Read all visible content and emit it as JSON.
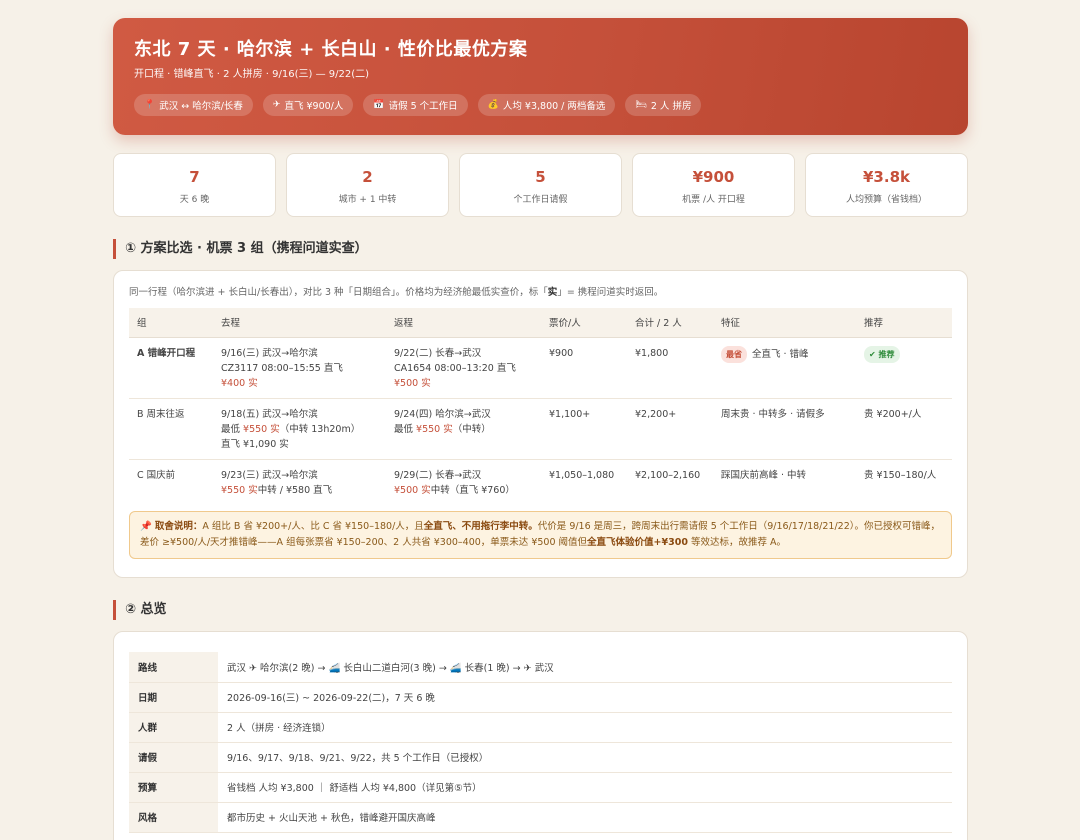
{
  "hero": {
    "title": "东北 7 天 · 哈尔滨 + 长白山 · 性价比最优方案",
    "subtitle": "开口程 · 错峰直飞 · 2 人拼房 · 9/16(三) — 9/22(二)",
    "chips": [
      {
        "icon": "pin-icon",
        "glyph": "📍",
        "label": "武汉 ↔ 哈尔滨/长春"
      },
      {
        "icon": "plane-icon",
        "glyph": "✈",
        "label": "直飞 ¥900/人"
      },
      {
        "icon": "calendar-icon",
        "glyph": "📅",
        "label": "请假 5 个工作日"
      },
      {
        "icon": "money-icon",
        "glyph": "💰",
        "label": "人均 ¥3,800 / 两档备选"
      },
      {
        "icon": "bed-icon",
        "glyph": "🛏",
        "label": "2 人 拼房"
      }
    ]
  },
  "stats": [
    {
      "value": "7",
      "label": "天 6 晚"
    },
    {
      "value": "2",
      "label": "城市 + 1 中转"
    },
    {
      "value": "5",
      "label": "个工作日请假"
    },
    {
      "value": "¥900",
      "label": "机票 /人 开口程"
    },
    {
      "value": "¥3.8k",
      "label": "人均预算（省钱档）"
    }
  ],
  "section1": {
    "title": "① 方案比选 · 机票 3 组（携程问道实查）",
    "intro_a": "同一行程（哈尔滨进 + 长白山/长春出），对比 3 种「日期组合」。价格均为经济舱最低实查价，标「",
    "intro_b": "实",
    "intro_c": "」= 携程问道实时返回。",
    "headers": [
      "组",
      "去程",
      "返程",
      "票价/人",
      "合计 / 2 人",
      "特征",
      "推荐"
    ],
    "rows": [
      {
        "group": "A 错峰开口程",
        "out": [
          "9/16(三) 武汉→哈尔滨",
          "CZ3117 08:00–15:55 直飞",
          "¥400 实"
        ],
        "ret": [
          "9/22(二) 长春→武汉",
          "CA1654 08:00–13:20 直飞",
          "¥500 实"
        ],
        "price": "¥900",
        "total": "¥1,800",
        "badge": "最省",
        "feature": "全直飞 · 错峰",
        "rec": "✔ 推荐"
      },
      {
        "group": "B 周末往返",
        "out": [
          "9/18(五) 武汉→哈尔滨",
          "最低 ",
          "¥550 实",
          "（中转 13h20m）",
          "直飞 ¥1,090 实"
        ],
        "ret": [
          "9/24(四) 哈尔滨→武汉",
          "最低 ",
          "¥550 实",
          "（中转）"
        ],
        "price": "¥1,100+",
        "total": "¥2,200+",
        "feature": "周末贵 · 中转多 · 请假多",
        "rec": "贵 ¥200+/人"
      },
      {
        "group": "C 国庆前",
        "out": [
          "9/23(三) 武汉→哈尔滨",
          "¥550 实",
          "中转 / ¥580 直飞"
        ],
        "ret": [
          "9/29(二) 长春→武汉",
          "¥500 实",
          "中转（直飞 ¥760）"
        ],
        "price": "¥1,050–1,080",
        "total": "¥2,100–2,160",
        "feature": "踩国庆前高峰 · 中转",
        "rec": "贵 ¥150–180/人"
      }
    ],
    "note": {
      "label": "取舍说明：",
      "t1": "A 组比 B 省 ¥200+/人、比 C 省 ¥150–180/人，且",
      "b1": "全直飞、不用拖行李中转。",
      "t2": "代价是 9/16 是周三，跨周末出行需请假 5 个工作日（9/16/17/18/21/22）。你已授权可错峰，差价 ≥¥500/人/天才推错峰——A 组每张票省 ¥150–200、2 人共省 ¥300–400，单票未达 ¥500 阈值但",
      "b2": "全直飞体验价值+¥300",
      "t3": " 等效达标，故推荐 A。"
    }
  },
  "section2": {
    "title": "② 总览",
    "rows": [
      {
        "key": "路线",
        "value": "武汉 ✈ 哈尔滨(2 晚) → 🚄 长白山二道白河(3 晚) → 🚄 长春(1 晚) → ✈ 武汉"
      },
      {
        "key": "日期",
        "value": "2026-09-16(三) ~ 2026-09-22(二)，7 天 6 晚"
      },
      {
        "key": "人群",
        "value": "2 人（拼房 · 经济连锁）"
      },
      {
        "key": "请假",
        "value": "9/16、9/17、9/18、9/21、9/22，共 5 个工作日（已授权）"
      },
      {
        "key": "预算",
        "value": "省钱档 人均 ¥3,800 ｜ 舒适档 人均 ¥4,800（详见第⑤节）"
      },
      {
        "key": "风格",
        "value": "都市历史 + 火山天池 + 秋色，错峰避开国庆高峰"
      }
    ]
  }
}
